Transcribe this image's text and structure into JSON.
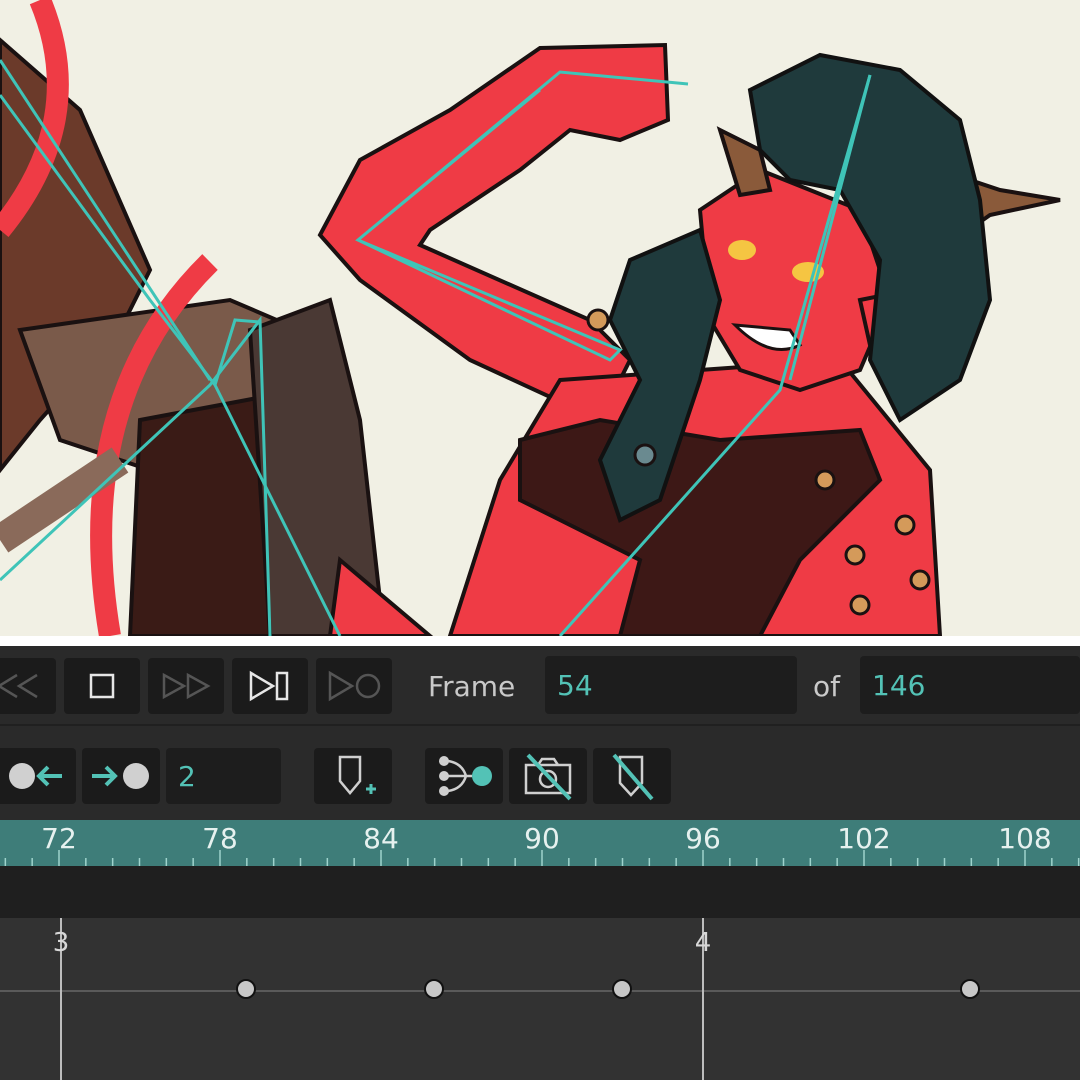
{
  "transport": {
    "frame_label": "Frame",
    "current_frame": "54",
    "of_label": "of",
    "total_frames": "146",
    "icons": [
      "rewind-icon",
      "stop-icon",
      "fast-forward-icon",
      "step-to-end-icon",
      "step-to-keyframe-icon"
    ]
  },
  "keyframe_tools": {
    "step_value": "2",
    "icons": [
      "prev-keyframe-icon",
      "next-keyframe-icon",
      "add-keyframe-icon",
      "bone-tree-icon",
      "camera-off-icon",
      "keyframe-off-icon"
    ]
  },
  "ruler": {
    "ticks": [
      "72",
      "78",
      "84",
      "90",
      "96",
      "102",
      "108"
    ]
  },
  "track": {
    "markers": [
      "3",
      "4"
    ],
    "keyframe_count": 4
  },
  "colors": {
    "accent": "#53c2b6",
    "ruler": "#3e7d79",
    "canvas": "#f1f0e4",
    "skin": "#ef3b45",
    "bone": "#3fc4b8"
  }
}
